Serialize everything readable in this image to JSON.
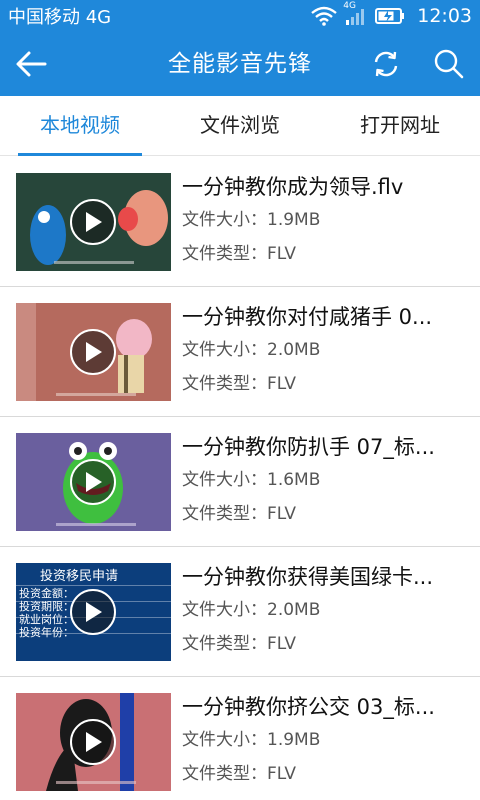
{
  "status": {
    "carrier": "中国移动 4G",
    "network_badge": "4G",
    "time": "12:03"
  },
  "appbar": {
    "title": "全能影音先锋"
  },
  "tabs": [
    {
      "label": "本地视频",
      "active": true
    },
    {
      "label": "文件浏览",
      "active": false
    },
    {
      "label": "打开网址",
      "active": false
    }
  ],
  "videos": [
    {
      "name": "一分钟教你成为领导.flv",
      "size": "文件大小：1.9MB",
      "type": "文件类型：FLV"
    },
    {
      "name": "一分钟教你对付咸猪手 0...",
      "size": "文件大小：2.0MB",
      "type": "文件类型：FLV"
    },
    {
      "name": "一分钟教你防扒手 07_标...",
      "size": "文件大小：1.6MB",
      "type": "文件类型：FLV"
    },
    {
      "name": "一分钟教你获得美国绿卡...",
      "size": "文件大小：2.0MB",
      "type": "文件类型：FLV"
    },
    {
      "name": "一分钟教你挤公交 03_标...",
      "size": "文件大小：1.9MB",
      "type": "文件类型：FLV"
    }
  ],
  "thumb4_text": {
    "heading": "投资移民申请",
    "lines": [
      "投资金额：",
      "投资期限：",
      "就业岗位：",
      "投资年份："
    ]
  },
  "colors": {
    "accent": "#1f88da"
  }
}
